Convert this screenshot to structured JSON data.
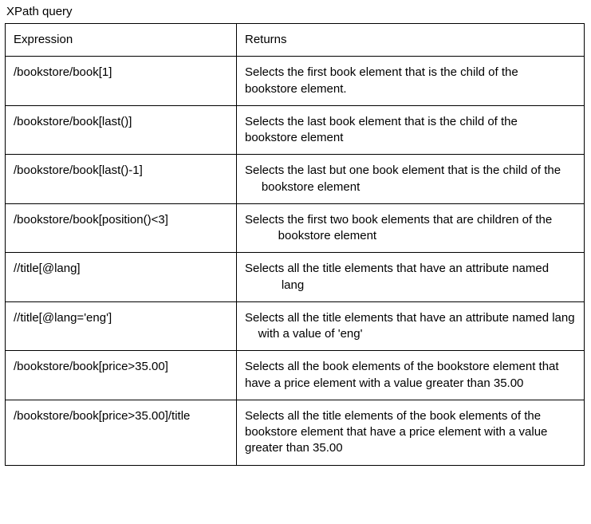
{
  "title": "XPath query",
  "headers": {
    "expression": "Expression",
    "returns": "Returns"
  },
  "rows": [
    {
      "expression": "/bookstore/book[1]",
      "returns": "Selects the first book element that is the child of the        bookstore element."
    },
    {
      "expression": "/bookstore/book[last()]",
      "returns": "Selects the last book element that is the child of the        bookstore element"
    },
    {
      "expression": "/bookstore/book[last()-1]",
      "returns": "Selects the last but one book element that is the child of the      bookstore element"
    },
    {
      "expression": "/bookstore/book[position()<3]",
      "returns": "Selects the first two book elements that are children of the           bookstore element"
    },
    {
      "expression": "//title[@lang]",
      "returns": "Selects all the title elements that have an attribute named            lang"
    },
    {
      "expression": "//title[@lang='eng']",
      "returns": "Selects all the title elements that have an attribute named lang     with a value of 'eng'"
    },
    {
      "expression": "/bookstore/book[price>35.00]",
      "returns": "Selects all the book elements of the bookstore element that    have a price element with a value greater than 35.00"
    },
    {
      "expression": "/bookstore/book[price>35.00]/title",
      "returns": "Selects all the title elements of the book elements of the          bookstore element that have a price element with a value greater than 35.00"
    }
  ]
}
